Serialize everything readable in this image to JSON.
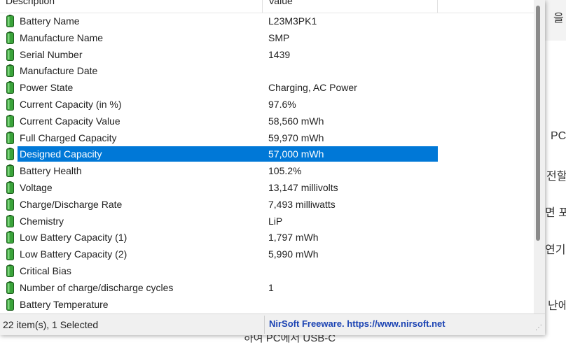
{
  "columns": {
    "description": "Description",
    "value": "Value"
  },
  "rows": [
    {
      "label": "Battery Name",
      "value": "L23M3PK1"
    },
    {
      "label": "Manufacture Name",
      "value": "SMP"
    },
    {
      "label": "Serial Number",
      "value": "1439"
    },
    {
      "label": "Manufacture Date",
      "value": ""
    },
    {
      "label": "Power State",
      "value": "Charging, AC Power"
    },
    {
      "label": "Current Capacity (in %)",
      "value": "97.6%"
    },
    {
      "label": "Current Capacity Value",
      "value": "58,560 mWh"
    },
    {
      "label": "Full Charged Capacity",
      "value": "59,970 mWh"
    },
    {
      "label": "Designed Capacity",
      "value": "57,000 mWh",
      "selected": true
    },
    {
      "label": "Battery Health",
      "value": "105.2%"
    },
    {
      "label": "Voltage",
      "value": "13,147 millivolts"
    },
    {
      "label": "Charge/Discharge Rate",
      "value": "7,493 milliwatts"
    },
    {
      "label": "Chemistry",
      "value": "LiP"
    },
    {
      "label": "Low Battery Capacity (1)",
      "value": "1,797 mWh"
    },
    {
      "label": "Low Battery Capacity (2)",
      "value": "5,990 mWh"
    },
    {
      "label": "Critical Bias",
      "value": ""
    },
    {
      "label": "Number of charge/discharge cycles",
      "value": "1"
    },
    {
      "label": "Battery Temperature",
      "value": ""
    }
  ],
  "status": {
    "count": "22 item(s), 1 Selected",
    "link": "NirSoft Freeware. https://www.nirsoft.net"
  },
  "background": {
    "fragments": [
      "을",
      "PC",
      "전할",
      "면 포",
      "연기",
      "난에"
    ],
    "bottom": "하여 PC에서 USB-C"
  },
  "colors": {
    "selection": "#0078d7",
    "link": "#1b43b3",
    "battery": "#3aa33a"
  },
  "icon": "battery-icon"
}
